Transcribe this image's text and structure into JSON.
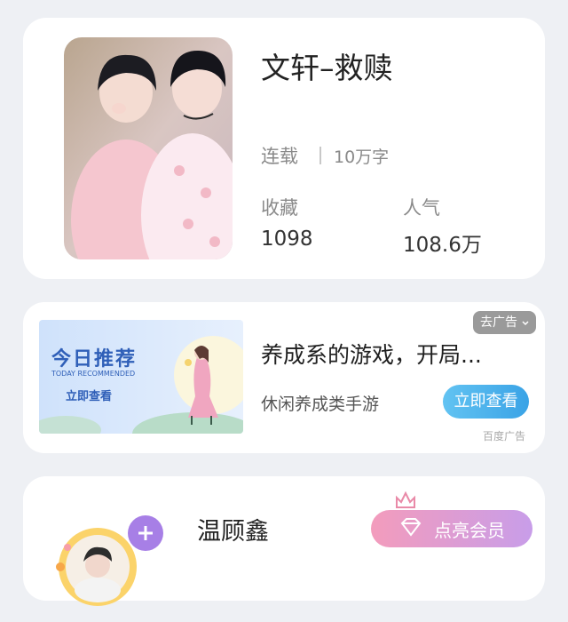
{
  "book": {
    "title": "文轩–救赎",
    "status": "连载",
    "word_count": "10万字",
    "stats": [
      {
        "label": "收藏",
        "value": "1098"
      },
      {
        "label": "人气",
        "value": "108.6万"
      }
    ]
  },
  "ad": {
    "close_label": "去广告",
    "banner": {
      "headline": "今日推荐",
      "subheadline": "TODAY RECOMMENDED",
      "cta": "立即查看"
    },
    "title": "养成系的游戏，开局...",
    "subtitle": "休闲养成类手游",
    "button_label": "立即查看",
    "source": "百度广告"
  },
  "author": {
    "name": "温顾鑫",
    "vip_label": "点亮会员"
  },
  "colors": {
    "page_bg": "#eef0f4",
    "card_bg": "#ffffff",
    "ad_button": "#3aa3e6",
    "vip_start": "#f39cbc",
    "vip_end": "#c89de9",
    "follow_plus": "#a77fe6"
  }
}
